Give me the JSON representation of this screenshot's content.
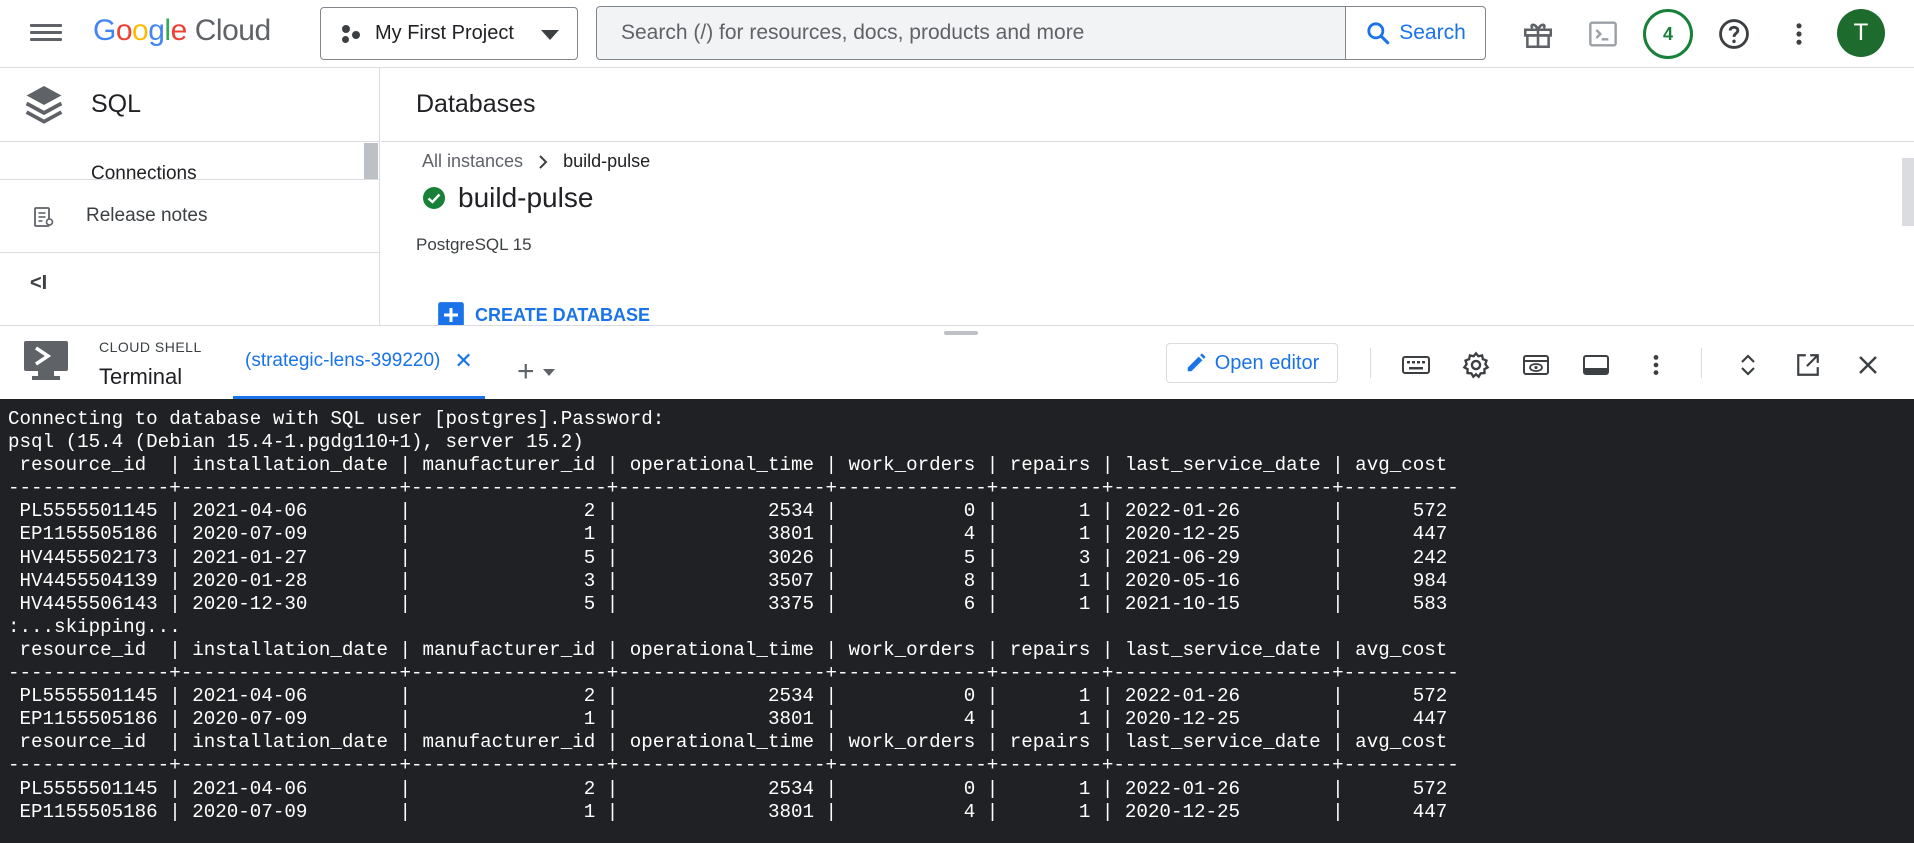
{
  "topbar": {
    "logo_letters": [
      "G",
      "o",
      "o",
      "g",
      "l",
      "e"
    ],
    "logo_cloud": "Cloud",
    "project_name": "My First Project",
    "search_placeholder": "Search (/) for resources, docs, products and more",
    "search_button": "Search",
    "notifications_count": "4",
    "avatar_initial": "T"
  },
  "nav": {
    "title": "SQL",
    "clipped_item": "Connections",
    "release_notes": "Release notes",
    "collapse": "<I"
  },
  "main": {
    "title": "Databases",
    "breadcrumb_root": "All instances",
    "breadcrumb_current": "build-pulse",
    "instance_name": "build-pulse",
    "engine": "PostgreSQL 15",
    "create_button": "CREATE DATABASE"
  },
  "shell": {
    "label": "CLOUD SHELL",
    "terminal_label": "Terminal",
    "tab_label": "(strategic-lens-399220)",
    "tab_close": "✕",
    "open_editor": "Open editor"
  },
  "terminal": {
    "lines": [
      "Connecting to database with SQL user [postgres].Password:",
      "psql (15.4 (Debian 15.4-1.pgdg110+1), server 15.2)",
      " resource_id  | installation_date | manufacturer_id | operational_time | work_orders | repairs | last_service_date | avg_cost",
      "--------------+-------------------+-----------------+------------------+-------------+---------+-------------------+----------",
      " PL5555501145 | 2021-04-06        |               2 |             2534 |           0 |       1 | 2022-01-26        |      572",
      " EP1155505186 | 2020-07-09        |               1 |             3801 |           4 |       1 | 2020-12-25        |      447",
      " HV4455502173 | 2021-01-27        |               5 |             3026 |           5 |       3 | 2021-06-29        |      242",
      " HV4455504139 | 2020-01-28        |               3 |             3507 |           8 |       1 | 2020-05-16        |      984",
      " HV4455506143 | 2020-12-30        |               5 |             3375 |           6 |       1 | 2021-10-15        |      583",
      ":...skipping...",
      " resource_id  | installation_date | manufacturer_id | operational_time | work_orders | repairs | last_service_date | avg_cost",
      "--------------+-------------------+-----------------+------------------+-------------+---------+-------------------+----------",
      " PL5555501145 | 2021-04-06        |               2 |             2534 |           0 |       1 | 2022-01-26        |      572",
      " EP1155505186 | 2020-07-09        |               1 |             3801 |           4 |       1 | 2020-12-25        |      447",
      " resource_id  | installation_date | manufacturer_id | operational_time | work_orders | repairs | last_service_date | avg_cost",
      "--------------+-------------------+-----------------+------------------+-------------+---------+-------------------+----------",
      " PL5555501145 | 2021-04-06        |               2 |             2534 |           0 |       1 | 2022-01-26        |      572",
      " EP1155505186 | 2020-07-09        |               1 |             3801 |           4 |       1 | 2020-12-25        |      447"
    ]
  },
  "colors": {
    "accent": "#1a73e8",
    "success": "#188038",
    "terminal_bg": "#202124",
    "terminal_fg": "#ffffff"
  },
  "icons": [
    "menu-icon",
    "project-icon",
    "search-icon",
    "gift-icon",
    "terminal-icon",
    "help-icon",
    "more-vert-icon",
    "sql-stack-icon",
    "release-notes-icon",
    "chevron-right-icon",
    "check-circle-icon",
    "add-box-icon",
    "cloud-shell-icon",
    "edit-icon",
    "keyboard-icon",
    "settings-icon",
    "preview-icon",
    "layout-icon",
    "expand-icon",
    "open-in-new-icon",
    "close-icon"
  ]
}
